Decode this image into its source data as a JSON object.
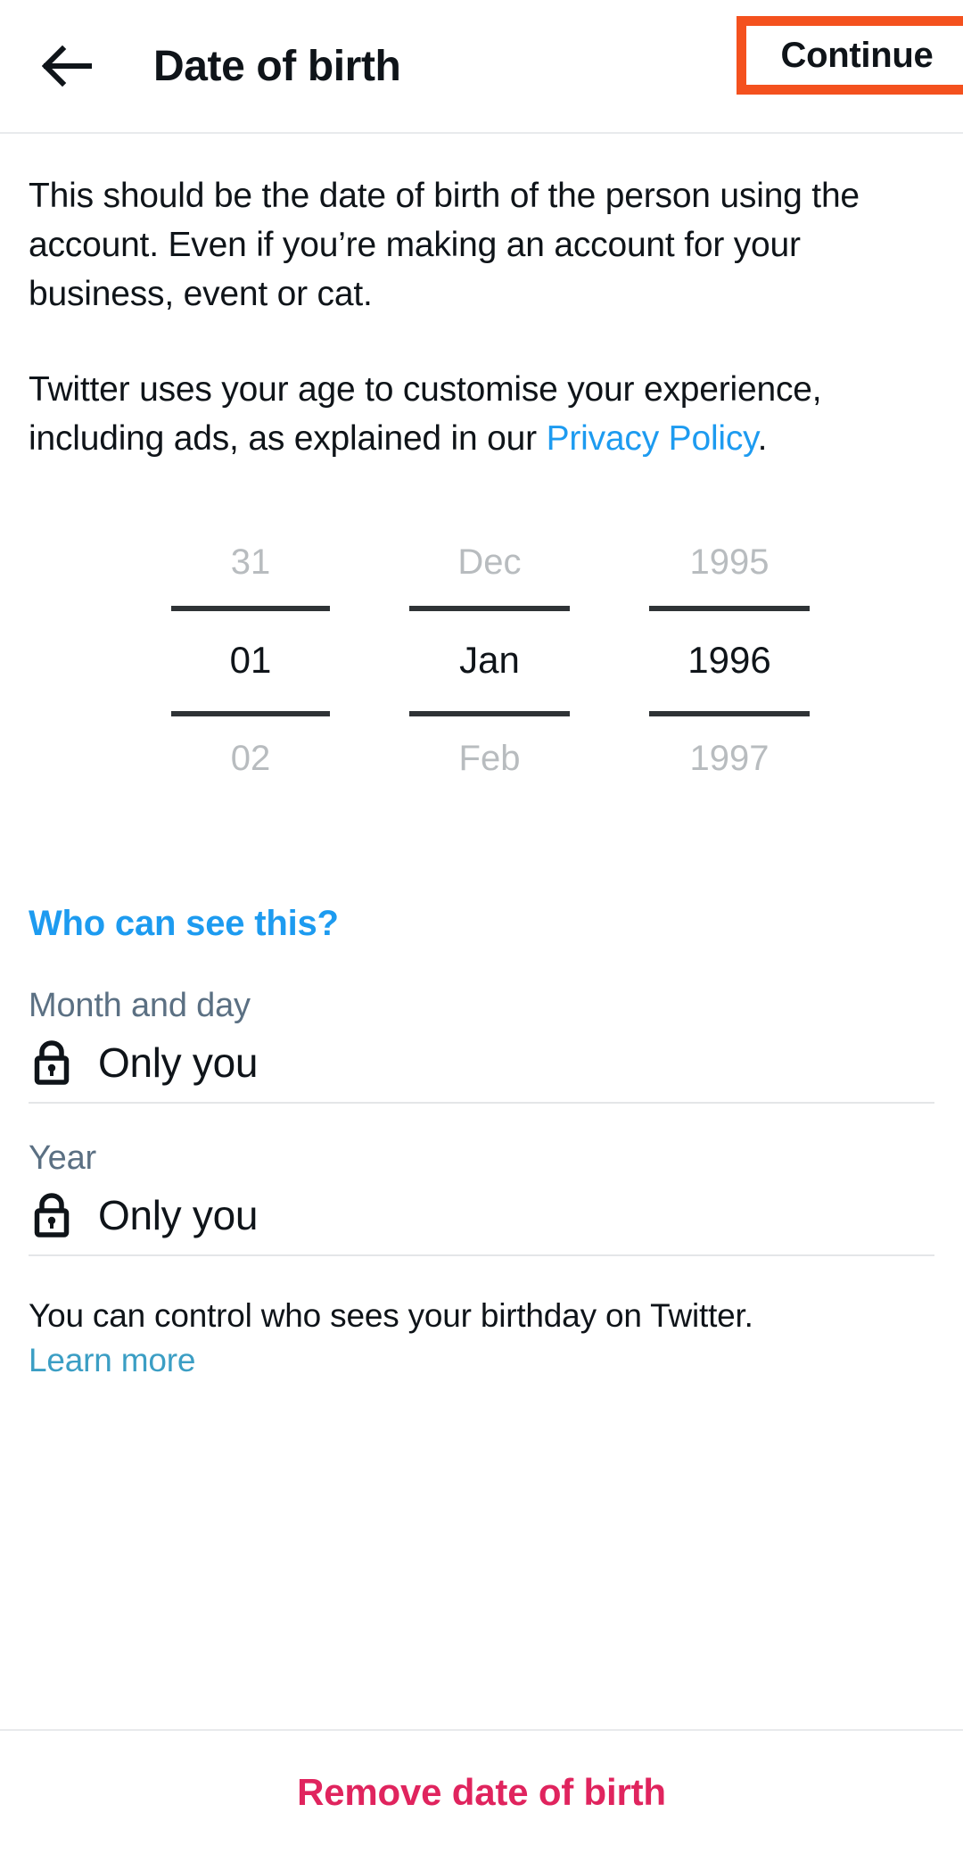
{
  "header": {
    "back_icon": "arrow-left-icon",
    "title": "Date of birth",
    "continue_label": "Continue",
    "highlight_color": "#f4511e"
  },
  "body": {
    "paragraph_1": "This should be the date of birth of the person using the account. Even if you’re making an account for your business, event or cat.",
    "paragraph_2_before": "Twitter uses your age to customise your experience, including ads, as explained in our ",
    "paragraph_2_link": "Privacy Policy",
    "paragraph_2_after": "."
  },
  "date_picker": {
    "day": {
      "previous": "31",
      "selected": "01",
      "next": "02"
    },
    "month": {
      "previous": "Dec",
      "selected": "Jan",
      "next": "Feb"
    },
    "year": {
      "previous": "1995",
      "selected": "1996",
      "next": "1997"
    }
  },
  "visibility": {
    "section_title": "Who can see this?",
    "title_color": "#1d9bf0",
    "rows": [
      {
        "label": "Month and day",
        "value": "Only you",
        "icon": "lock-icon"
      },
      {
        "label": "Year",
        "value": "Only you",
        "icon": "lock-icon"
      }
    ],
    "footnote": "You can control who sees your birthday on Twitter.",
    "learn_more": "Learn more"
  },
  "footer": {
    "remove_label": "Remove date of birth",
    "remove_color": "#e0245e"
  }
}
